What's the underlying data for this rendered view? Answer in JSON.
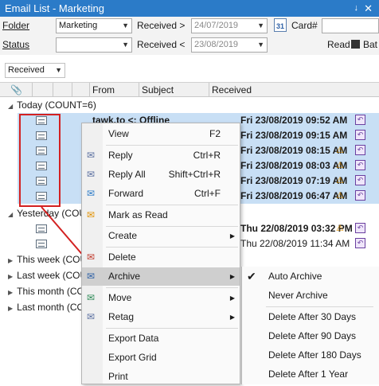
{
  "window": {
    "title": "Email List - Marketing"
  },
  "filters": {
    "folder_label": "Folder",
    "folder_value": "Marketing",
    "status_label": "Status",
    "status_value": "",
    "received_gt_label": "Received >",
    "received_gt_value": "24/07/2019",
    "received_lt_label": "Received <",
    "received_lt_value": "23/08/2019",
    "card_label": "Card#",
    "read_label": "Read",
    "batch_label": "Bat",
    "calendar_text": "31"
  },
  "groupby": {
    "value": "Received"
  },
  "columns": [
    "From",
    "Subject",
    "Received"
  ],
  "groups": [
    {
      "label": "Today (COUNT=6)"
    },
    {
      "label": "Yesterday (COUN"
    },
    {
      "label": "This week (COUN"
    },
    {
      "label": "Last week (COUN"
    },
    {
      "label": "This month (COUN"
    },
    {
      "label": "Last month (COUN"
    }
  ],
  "today_rows": [
    {
      "subject": "tawk.to <: Offline",
      "received": "Fri 23/08/2019 09:52 AM"
    },
    {
      "received": "Fri 23/08/2019 09:15 AM"
    },
    {
      "received": "Fri 23/08/2019 08:15 AM"
    },
    {
      "received": "Fri 23/08/2019 08:03 AM"
    },
    {
      "received": "Fri 23/08/2019 07:19 AM"
    },
    {
      "received": "Fri 23/08/2019 06:47 AM"
    }
  ],
  "yesterday_rows": [
    {
      "received": "Thu 22/08/2019 03:32 PM"
    },
    {
      "received": "Thu 22/08/2019 11:34 AM"
    }
  ],
  "context_menu": {
    "items": [
      {
        "label": "View",
        "shortcut": "F2"
      },
      {
        "label": "Reply",
        "shortcut": "Ctrl+R"
      },
      {
        "label": "Reply All",
        "shortcut": "Shift+Ctrl+R"
      },
      {
        "label": "Forward",
        "shortcut": "Ctrl+F"
      },
      {
        "label": "Mark as Read"
      },
      {
        "label": "Create"
      },
      {
        "label": "Delete"
      },
      {
        "label": "Archive"
      },
      {
        "label": "Move"
      },
      {
        "label": "Retag"
      },
      {
        "label": "Export Data"
      },
      {
        "label": "Export Grid"
      },
      {
        "label": "Print"
      }
    ]
  },
  "archive_submenu": {
    "items": [
      {
        "label": "Auto Archive"
      },
      {
        "label": "Never Archive"
      },
      {
        "label": "Delete After 30 Days"
      },
      {
        "label": "Delete After 90 Days"
      },
      {
        "label": "Delete After 180 Days"
      },
      {
        "label": "Delete After 1 Year"
      }
    ]
  },
  "colors": {
    "title_bar": "#2b7bc8",
    "selection": "#c8dff5",
    "annotation": "#d32121"
  }
}
